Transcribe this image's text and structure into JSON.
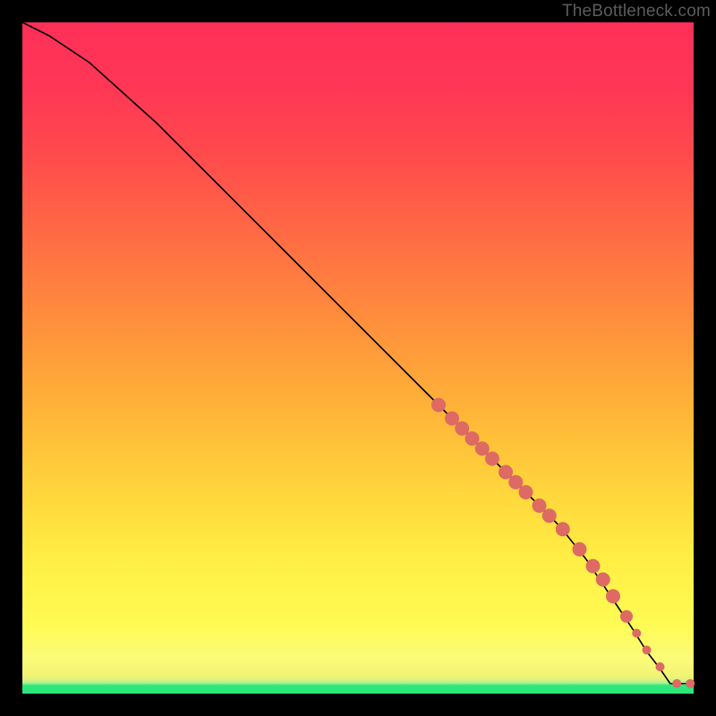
{
  "attribution": "TheBottleneck.com",
  "chart_data": {
    "type": "line",
    "title": "",
    "xlabel": "",
    "ylabel": "",
    "xlim": [
      0,
      100
    ],
    "ylim": [
      0,
      100
    ],
    "curve": {
      "name": "bottleneck-curve",
      "x": [
        0,
        4,
        10,
        20,
        30,
        40,
        50,
        60,
        64,
        68,
        72,
        76,
        80,
        84,
        88,
        91,
        93,
        95,
        96.5,
        100
      ],
      "y": [
        100,
        98,
        94,
        85,
        75,
        65,
        55,
        45,
        41,
        37,
        33,
        29,
        25,
        20,
        14,
        9.5,
        6.3,
        3.7,
        1.5,
        1.5
      ]
    },
    "points": {
      "name": "data-points",
      "color": "#dd6a63",
      "x": [
        62,
        64,
        65.5,
        67,
        68.5,
        70,
        72,
        73.5,
        75,
        77,
        78.5,
        80.5,
        83,
        85,
        86.5,
        88,
        90,
        91.5,
        93,
        95,
        97.5,
        99.5
      ],
      "y": [
        43,
        41,
        39.5,
        38,
        36.5,
        35,
        33,
        31.5,
        30,
        28,
        26.5,
        24.5,
        21.5,
        19,
        17,
        14.5,
        11.5,
        9,
        6.5,
        4,
        1.5,
        1.5
      ],
      "r": [
        8,
        8,
        8,
        8,
        8,
        8,
        8,
        8,
        8,
        8,
        8,
        8,
        8,
        8,
        8,
        8,
        7,
        5,
        5,
        5,
        5,
        5
      ]
    }
  }
}
